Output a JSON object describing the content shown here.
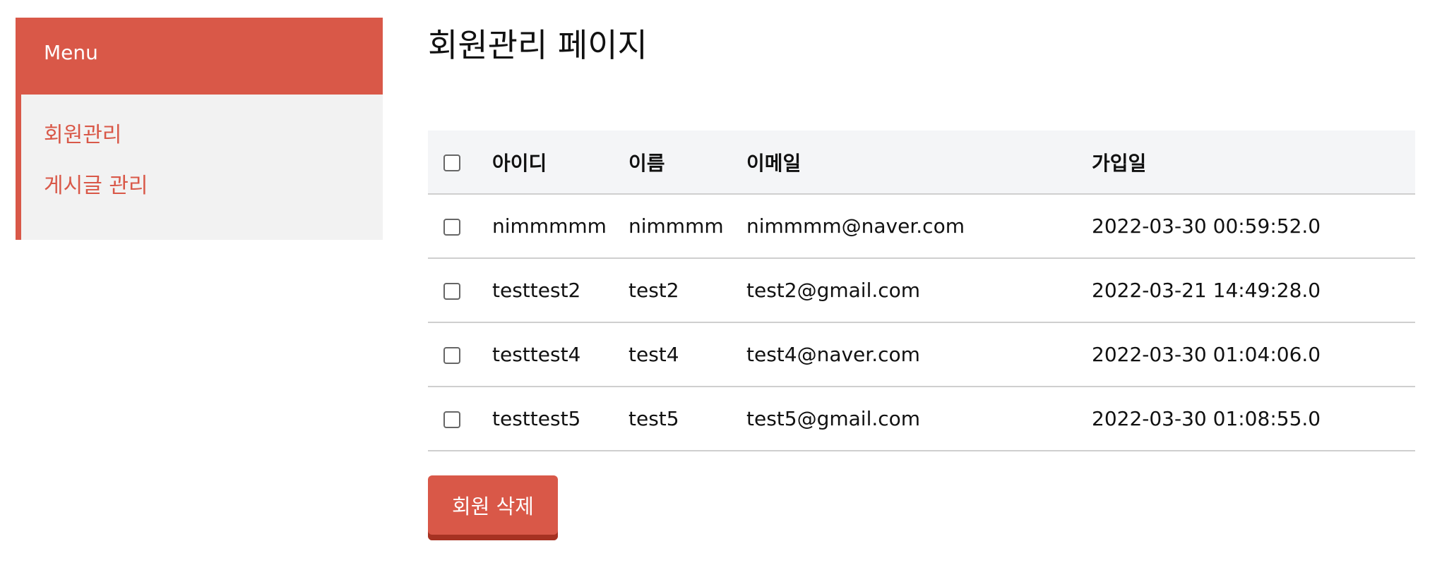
{
  "sidebar": {
    "title": "Menu",
    "items": [
      {
        "label": "회원관리"
      },
      {
        "label": "게시글 관리"
      }
    ]
  },
  "page": {
    "title": "회원관리 페이지"
  },
  "table": {
    "headers": {
      "id": "아이디",
      "name": "이름",
      "email": "이메일",
      "joined": "가입일"
    },
    "rows": [
      {
        "id": "nimmmmm",
        "name": "nimmmm",
        "email": "nimmmm@naver.com",
        "joined": "2022-03-30 00:59:52.0"
      },
      {
        "id": "testtest2",
        "name": "test2",
        "email": "test2@gmail.com",
        "joined": "2022-03-21 14:49:28.0"
      },
      {
        "id": "testtest4",
        "name": "test4",
        "email": "test4@naver.com",
        "joined": "2022-03-30 01:04:06.0"
      },
      {
        "id": "testtest5",
        "name": "test5",
        "email": "test5@gmail.com",
        "joined": "2022-03-30 01:08:55.0"
      }
    ]
  },
  "actions": {
    "delete_label": "회원 삭제"
  },
  "colors": {
    "accent": "#d95848",
    "accent_dark": "#a63222",
    "sidebar_bg": "#f2f2f2",
    "table_header_bg": "#f4f5f7"
  }
}
